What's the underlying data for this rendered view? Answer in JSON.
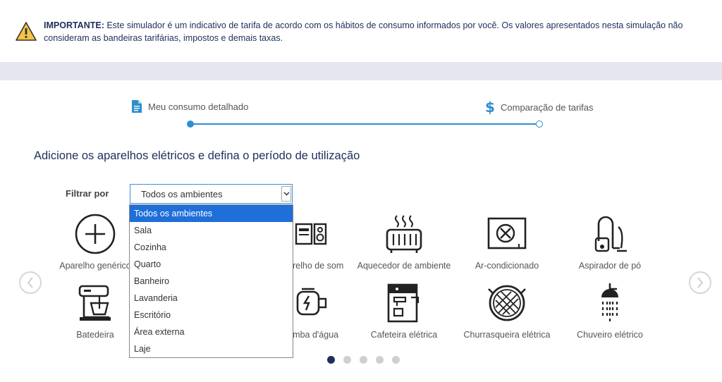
{
  "notice": {
    "bold": "IMPORTANTE:",
    "text": " Este simulador é um indicativo de tarifa de acordo com os hábitos de consumo informados por você. Os valores apresentados nesta simulação não consideram as bandeiras tarifárias, impostos e demais taxas."
  },
  "steps": [
    {
      "label": "Meu consumo detalhado",
      "icon": "document-icon"
    },
    {
      "label": "Comparação de tarifas",
      "icon": "dollar-icon"
    }
  ],
  "section_title": "Adicione os aparelhos elétricos e defina o período de utilização",
  "filter": {
    "label": "Filtrar por",
    "selected": "Todos os ambientes",
    "options": [
      "Todos os ambientes",
      "Sala",
      "Cozinha",
      "Quarto",
      "Banheiro",
      "Lavanderia",
      "Escritório",
      "Área externa",
      "Laje"
    ]
  },
  "appliances": {
    "row1": [
      "Aparelho genérico",
      "Aparelho de som",
      "Aquecedor de ambiente",
      "Ar-condicionado",
      "Aspirador de pó"
    ],
    "row2": [
      "Batedeira",
      "Bomba d'água",
      "Cafeteira elétrica",
      "Churrasqueira elétrica",
      "Chuveiro elétrico"
    ]
  },
  "pager": {
    "count": 5,
    "active": 0
  },
  "colors": {
    "accent": "#2d8ed0",
    "navy": "#1d2f5a",
    "selected_option": "#1e6fd9",
    "band": "#e5e6ef"
  }
}
